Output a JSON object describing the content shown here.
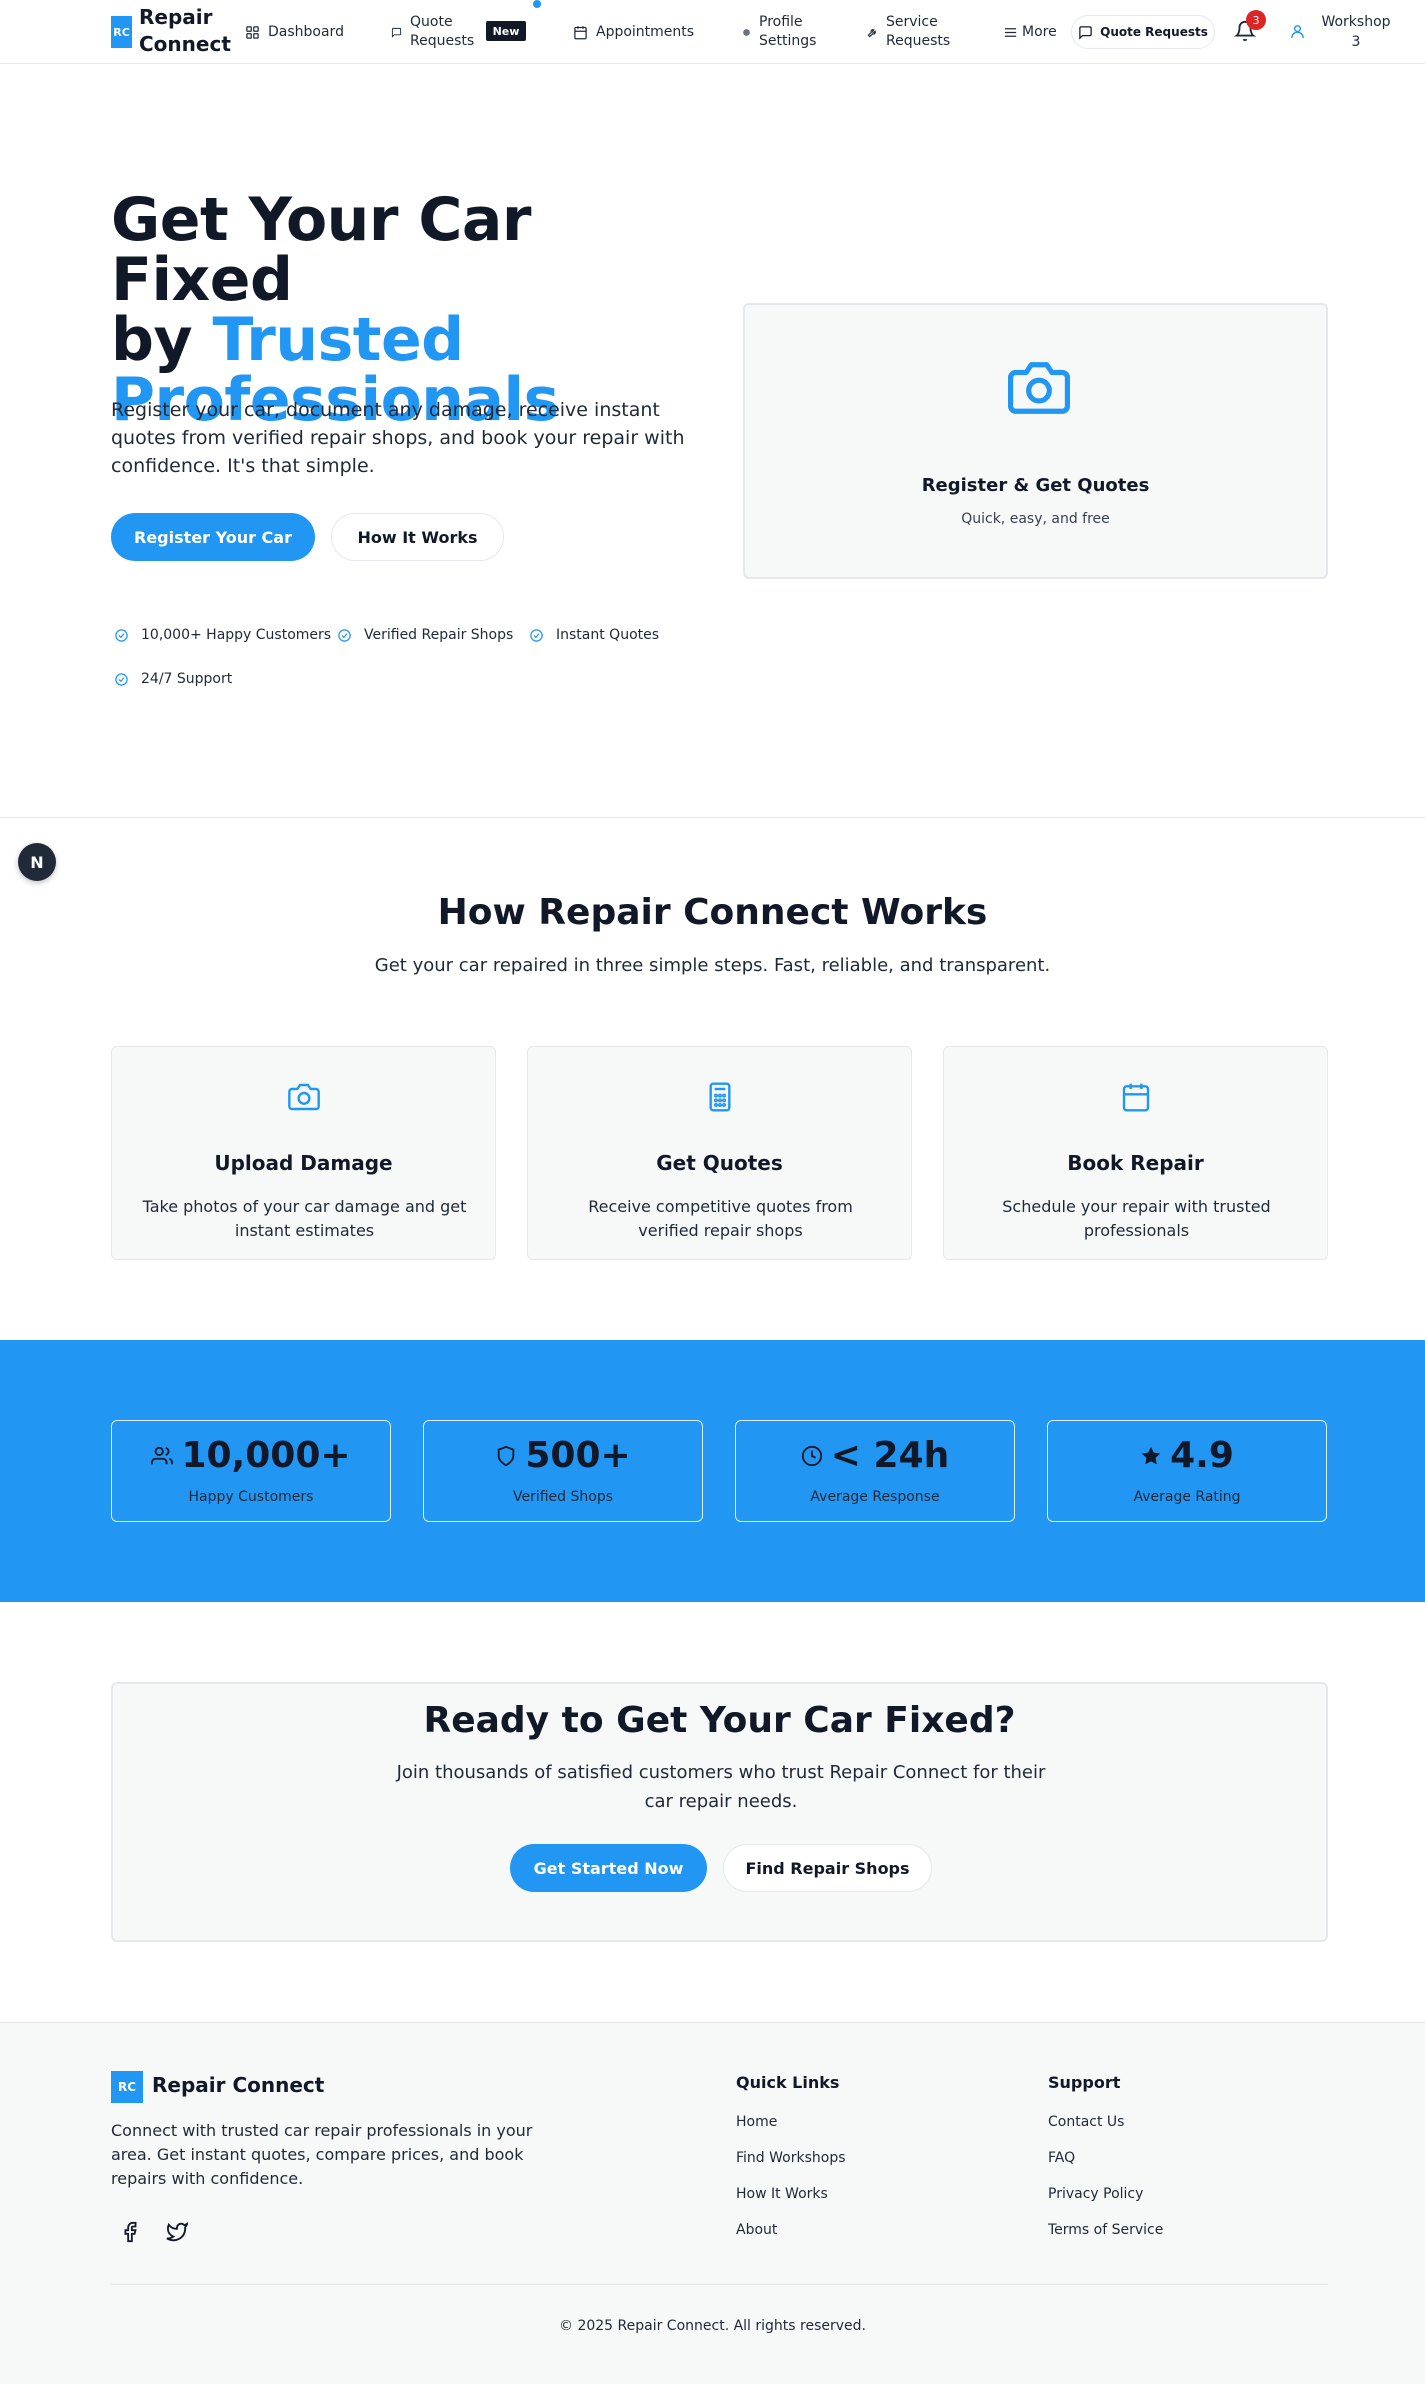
{
  "header": {
    "logo_abbr": "RC",
    "logo_text": "Repair Connect",
    "nav": {
      "dashboard": "Dashboard",
      "quote_requests": "Quote Requests",
      "new_badge": "New",
      "appointments": "Appointments",
      "profile_settings": "Profile Settings",
      "service_requests": "Service Requests",
      "more": "More"
    },
    "quote_button": "Quote Requests",
    "notification_count": "3",
    "user_name": "Workshop 3"
  },
  "hero": {
    "title_line1": "Get Your Car Fixed",
    "title_by": "by ",
    "title_accent1": "Trusted",
    "title_accent2": "Professionals",
    "subtitle": "Register your car, document any damage, receive instant quotes from verified repair shops, and book your repair with confidence. It's that simple.",
    "primary_button": "Register Your Car",
    "secondary_button": "How It Works",
    "features": [
      "10,000+ Happy Customers",
      "Verified Repair Shops",
      "Instant Quotes",
      "24/7 Support"
    ],
    "card_title": "Register & Get Quotes",
    "card_subtitle": "Quick, easy, and free"
  },
  "dev_badge": "N",
  "how": {
    "title": "How Repair Connect Works",
    "subtitle": "Get your car repaired in three simple steps. Fast, reliable, and transparent.",
    "steps": [
      {
        "icon": "camera-icon",
        "title": "Upload Damage",
        "desc": "Take photos of your car damage and get instant estimates"
      },
      {
        "icon": "calculator-icon",
        "title": "Get Quotes",
        "desc": "Receive competitive quotes from verified repair shops"
      },
      {
        "icon": "calendar-icon",
        "title": "Book Repair",
        "desc": "Schedule your repair with trusted professionals"
      }
    ]
  },
  "stats": [
    {
      "icon": "users-icon",
      "value": "10,000+",
      "label": "Happy Customers"
    },
    {
      "icon": "shield-icon",
      "value": "500+",
      "label": "Verified Shops"
    },
    {
      "icon": "clock-icon",
      "value": "< 24h",
      "label": "Average Response"
    },
    {
      "icon": "star-icon",
      "value": "4.9",
      "label": "Average Rating"
    }
  ],
  "cta": {
    "title": "Ready to Get Your Car Fixed?",
    "subtitle": "Join thousands of satisfied customers who trust Repair Connect for their car repair needs.",
    "primary_button": "Get Started Now",
    "secondary_button": "Find Repair Shops"
  },
  "footer": {
    "logo_abbr": "RC",
    "logo_text": "Repair Connect",
    "description": "Connect with trusted car repair professionals in your area. Get instant quotes, compare prices, and book repairs with confidence.",
    "quick_links_title": "Quick Links",
    "quick_links": [
      "Home",
      "Find Workshops",
      "How It Works",
      "About"
    ],
    "support_title": "Support",
    "support_links": [
      "Contact Us",
      "FAQ",
      "Privacy Policy",
      "Terms of Service"
    ],
    "copyright": "© 2025 Repair Connect. All rights reserved."
  },
  "colors": {
    "primary": "#2196f3",
    "dark": "#111827",
    "notification": "#dc2626",
    "card_bg": "#f7f8f8",
    "border": "#e5e7eb"
  }
}
